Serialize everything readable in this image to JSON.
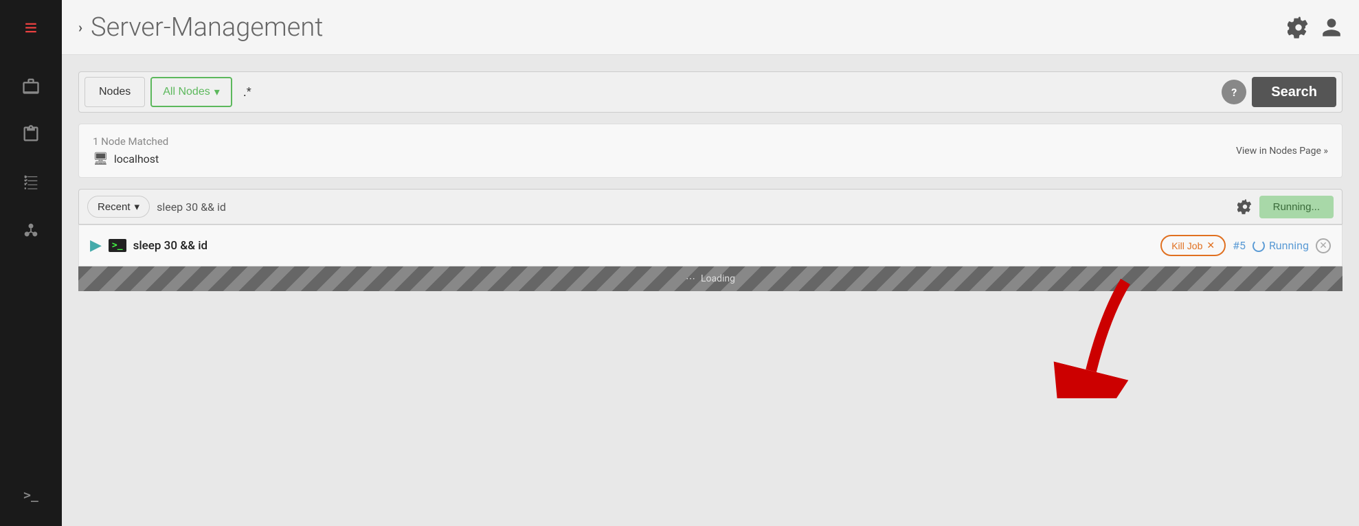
{
  "sidebar": {
    "logo": "≡",
    "items": [
      {
        "id": "briefcase",
        "icon": "briefcase",
        "label": "Jobs"
      },
      {
        "id": "clipboard",
        "icon": "clipboard",
        "label": "Commands"
      },
      {
        "id": "tasklist",
        "icon": "tasklist",
        "label": "Activity"
      },
      {
        "id": "network",
        "icon": "network",
        "label": "Nodes"
      }
    ],
    "terminal_label": ">_"
  },
  "topbar": {
    "breadcrumb_arrow": "›",
    "title": "Server-Management",
    "settings_icon": "gear",
    "user_icon": "user"
  },
  "search": {
    "nodes_label": "Nodes",
    "all_nodes_label": "All Nodes",
    "dropdown_arrow": "▾",
    "input_value": ".*",
    "help_label": "?",
    "search_label": "Search"
  },
  "node_matched": {
    "matched_text": "1 Node Matched",
    "node_name": "localhost",
    "view_link": "View in Nodes Page »"
  },
  "command": {
    "recent_label": "Recent",
    "dropdown_arrow": "▾",
    "command_text": "sleep 30 && id",
    "running_label": "Running..."
  },
  "job": {
    "command": "sleep 30 && id",
    "kill_label": "Kill Job",
    "kill_x": "✕",
    "job_number": "#5",
    "running_label": "Running",
    "close_x": "✕"
  },
  "loading": {
    "label": "Loading"
  },
  "colors": {
    "accent_red": "#e84040",
    "accent_green": "#5cb85c",
    "accent_blue": "#5b9bd5",
    "accent_orange": "#e07020"
  }
}
